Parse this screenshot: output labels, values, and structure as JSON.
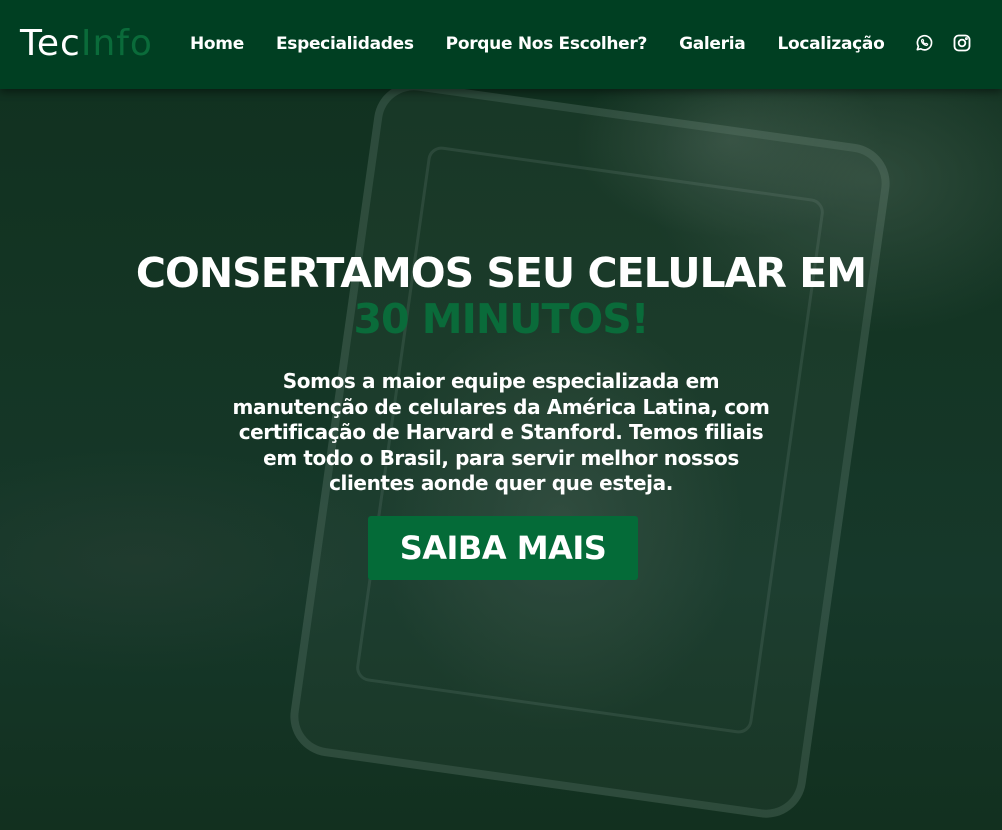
{
  "header": {
    "logo_part1": "Tec",
    "logo_part2": "Info",
    "nav": [
      "Home",
      "Especialidades",
      "Porque Nos Escolher?",
      "Galeria",
      "Localização"
    ],
    "social_icons": [
      "whatsapp-icon",
      "instagram-icon"
    ]
  },
  "hero": {
    "title_line1": "CONSERTAMOS SEU CELULAR EM",
    "title_line2": "30 MINUTOS!",
    "description": "Somos a maior equipe especializada em manutenção de celulares da América Latina, com certificação de Harvard e Stanford. Temos filiais em todo o Brasil, para servir melhor nossos clientes aonde quer que esteja.",
    "cta_label": "SAIBA MAIS"
  },
  "colors": {
    "header_bg": "#003f22",
    "accent_green": "#0a6b3a",
    "button_bg": "#046b38",
    "text": "#ffffff"
  }
}
